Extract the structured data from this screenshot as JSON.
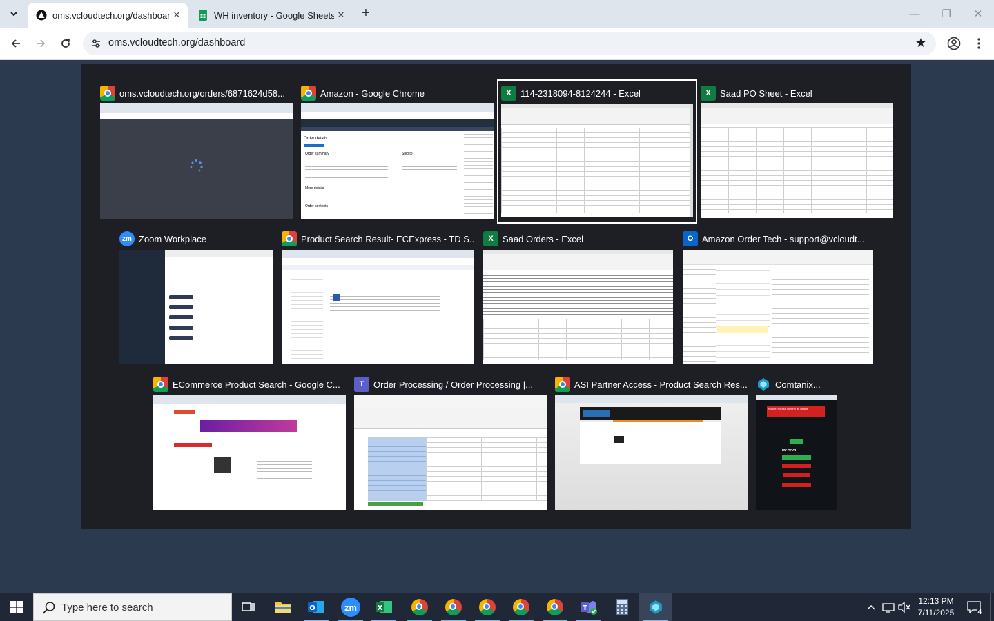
{
  "browser": {
    "tabs": [
      {
        "title": "oms.vcloudtech.org/dashboard",
        "active": true
      },
      {
        "title": "WH inventory - Google Sheets",
        "active": false
      }
    ],
    "url": "oms.vcloudtech.org/dashboard"
  },
  "task_view": {
    "windows": [
      {
        "title": "oms.vcloudtech.org/orders/6871624d58...",
        "icon": "chrome-icon"
      },
      {
        "title": "Amazon - Google Chrome",
        "icon": "chrome-icon"
      },
      {
        "title": "114-2318094-8124244 - Excel",
        "icon": "excel-icon",
        "selected": true
      },
      {
        "title": "Saad PO Sheet - Excel",
        "icon": "excel-icon"
      },
      {
        "title": "Zoom Workplace",
        "icon": "zoom-icon"
      },
      {
        "title": "Product Search Result- ECExpress - TD S...",
        "icon": "chrome-icon"
      },
      {
        "title": "Saad Orders - Excel",
        "icon": "excel-icon"
      },
      {
        "title": "Amazon Order Tech - support@vcloudt...",
        "icon": "outlook-icon"
      },
      {
        "title": "ECommerce Product Search - Google C...",
        "icon": "chrome-icon"
      },
      {
        "title": "Order Processing / Order Processing |...",
        "icon": "teams-icon"
      },
      {
        "title": "ASI Partner Access - Product Search Res...",
        "icon": "chrome-icon"
      },
      {
        "title": "Comtanix...",
        "icon": "comtanix-icon"
      }
    ],
    "thumb_text": {
      "amazon_order_details": "Order details",
      "amazon_ship_to": "Ship to",
      "amazon_order_summary": "Order summary",
      "amazon_more_details": "More details",
      "amazon_order_contents": "Order contents",
      "comtanix_warning": "Notice: Please confirm all details",
      "comtanix_clock": "09:29:29",
      "excel_letter": "X",
      "zoom_letters": "zm",
      "outlook_letter": "O",
      "teams_letter": "T"
    }
  },
  "taskbar": {
    "search_placeholder": "Type here to search",
    "time": "12:13 PM",
    "date": "7/11/2025",
    "notification_count": "4",
    "zoom_label": "zm"
  }
}
